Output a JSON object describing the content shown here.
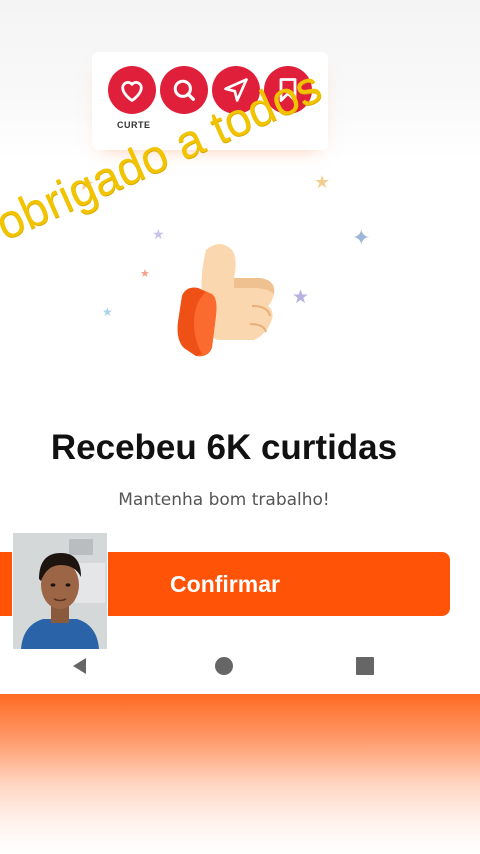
{
  "logo": {
    "label": "CURTE",
    "icons": [
      "heart-icon",
      "search-icon",
      "send-icon",
      "bookmark-icon"
    ],
    "color": "#e0203a"
  },
  "overlay": {
    "text": "obrigado a todos",
    "color": "#f2c400"
  },
  "illustration": "thumbs-up",
  "dialog": {
    "title": "Recebeu 6K curtidas",
    "subtitle": "Mantenha bom trabalho!",
    "confirm_label": "Confirmar",
    "accent": "#ff5308"
  },
  "nav": {
    "icons": [
      "back-icon",
      "home-icon",
      "recents-icon"
    ]
  }
}
